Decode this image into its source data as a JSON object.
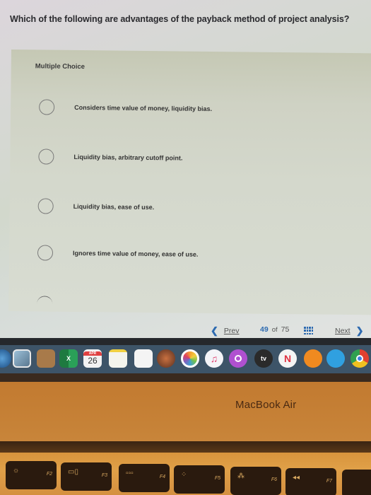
{
  "question": {
    "text": "Which of the following are advantages of the payback method of project analysis?"
  },
  "multiple_choice": {
    "label": "Multiple Choice",
    "options": [
      {
        "text": "Considers time value of money, liquidity bias.",
        "selected": false
      },
      {
        "text": "Liquidity bias, arbitrary cutoff point.",
        "selected": false
      },
      {
        "text": "Liquidity bias, ease of use.",
        "selected": false
      },
      {
        "text": "Ignores time value of money, ease of use.",
        "selected": false
      }
    ]
  },
  "navigation": {
    "prev_label": "Prev",
    "prev_icon": "chevron-left-icon",
    "current_page": "49",
    "of_label": "of",
    "total_pages": "75",
    "grid_icon": "grid-icon",
    "next_label": "Next",
    "next_icon": "chevron-right-icon",
    "accent_color": "#2d6ab0"
  },
  "dock": {
    "apps": [
      {
        "name": "Safari",
        "icon": "compass-icon"
      },
      {
        "name": "Preview",
        "icon": "photo-icon"
      },
      {
        "name": "Contacts",
        "icon": "contacts-icon"
      },
      {
        "name": "Excel",
        "icon": "excel-icon",
        "glyph": "X"
      },
      {
        "name": "Calendar",
        "icon": "calendar-icon",
        "month": "APR",
        "day": "26"
      },
      {
        "name": "Notes",
        "icon": "notes-icon"
      },
      {
        "name": "Reminders",
        "icon": "reminders-icon"
      },
      {
        "name": "Photo Booth",
        "icon": "photo-booth-icon"
      },
      {
        "name": "Photos",
        "icon": "photos-icon"
      },
      {
        "name": "Music",
        "icon": "music-icon",
        "glyph": "♫"
      },
      {
        "name": "Podcasts",
        "icon": "podcasts-icon"
      },
      {
        "name": "TV",
        "icon": "apple-tv-icon",
        "glyph": "tv"
      },
      {
        "name": "News",
        "icon": "news-icon"
      },
      {
        "name": "Books",
        "icon": "books-icon"
      },
      {
        "name": "Messages",
        "icon": "messages-icon"
      },
      {
        "name": "Chrome",
        "icon": "chrome-icon"
      }
    ]
  },
  "laptop": {
    "brand": "MacBook Air",
    "keys": [
      {
        "fn": "F2",
        "icon": "brightness-up-icon"
      },
      {
        "fn": "F3",
        "icon": "mission-control-icon"
      },
      {
        "fn": "F4",
        "icon": "launchpad-icon"
      },
      {
        "fn": "F5",
        "icon": "keyboard-light-down-icon"
      },
      {
        "fn": "F6",
        "icon": "keyboard-light-up-icon"
      },
      {
        "fn": "F7",
        "icon": "rewind-icon"
      }
    ]
  }
}
